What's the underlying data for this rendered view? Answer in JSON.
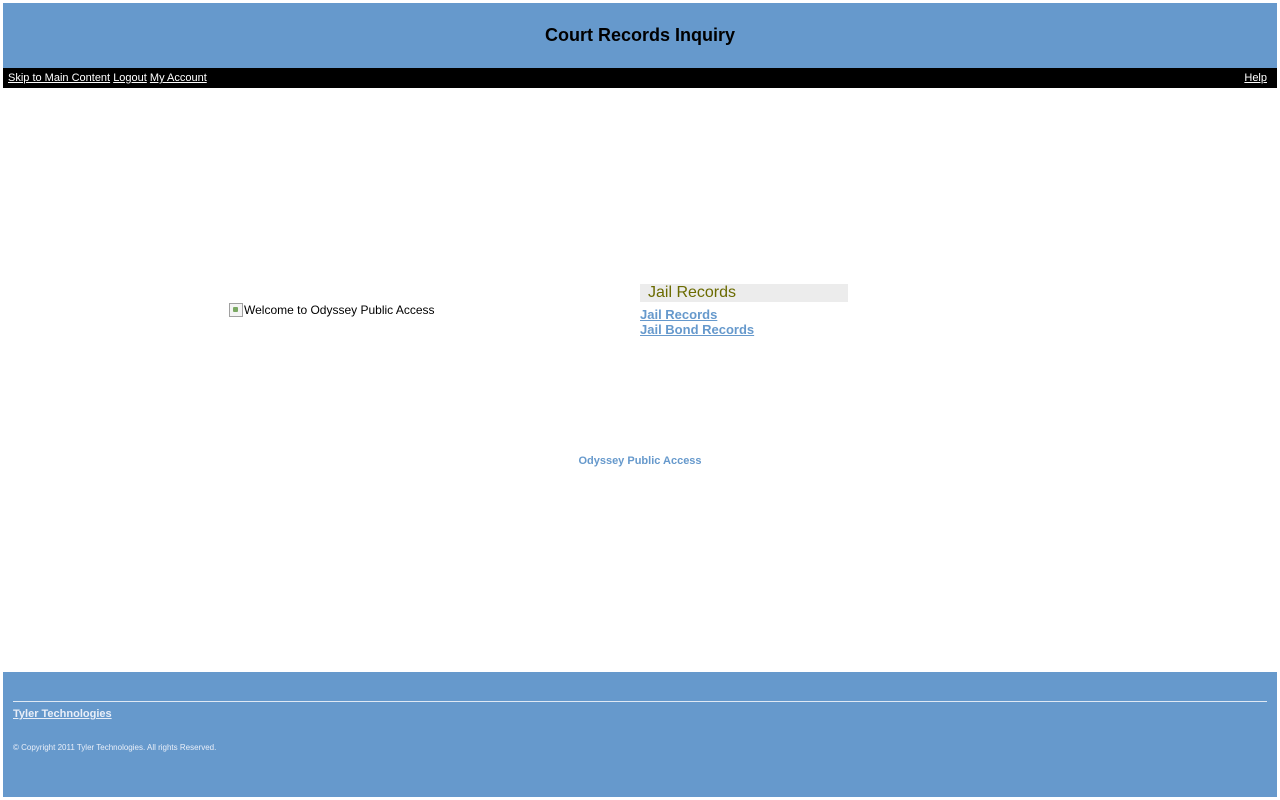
{
  "header": {
    "title": "Court Records Inquiry"
  },
  "navbar": {
    "skip_link": "Skip to Main Content",
    "logout_link": "Logout",
    "account_link": "My Account",
    "help_link": "Help"
  },
  "main": {
    "welcome_image_alt": "Welcome to Odyssey Public Access",
    "jail_section": {
      "heading": "Jail Records",
      "links": [
        "Jail Records",
        "Jail Bond Records"
      ]
    },
    "product_title": "Odyssey Public Access"
  },
  "footer": {
    "company_link": "Tyler Technologies",
    "copyright": "© Copyright 2011 Tyler Technologies. All rights Reserved."
  },
  "colors": {
    "brand_blue": "#6699cc",
    "nav_black": "#000000",
    "section_heading_text": "#6b6b00",
    "section_heading_bg": "#ececec"
  },
  "icons": {
    "welcome_image": "broken-image-icon"
  }
}
